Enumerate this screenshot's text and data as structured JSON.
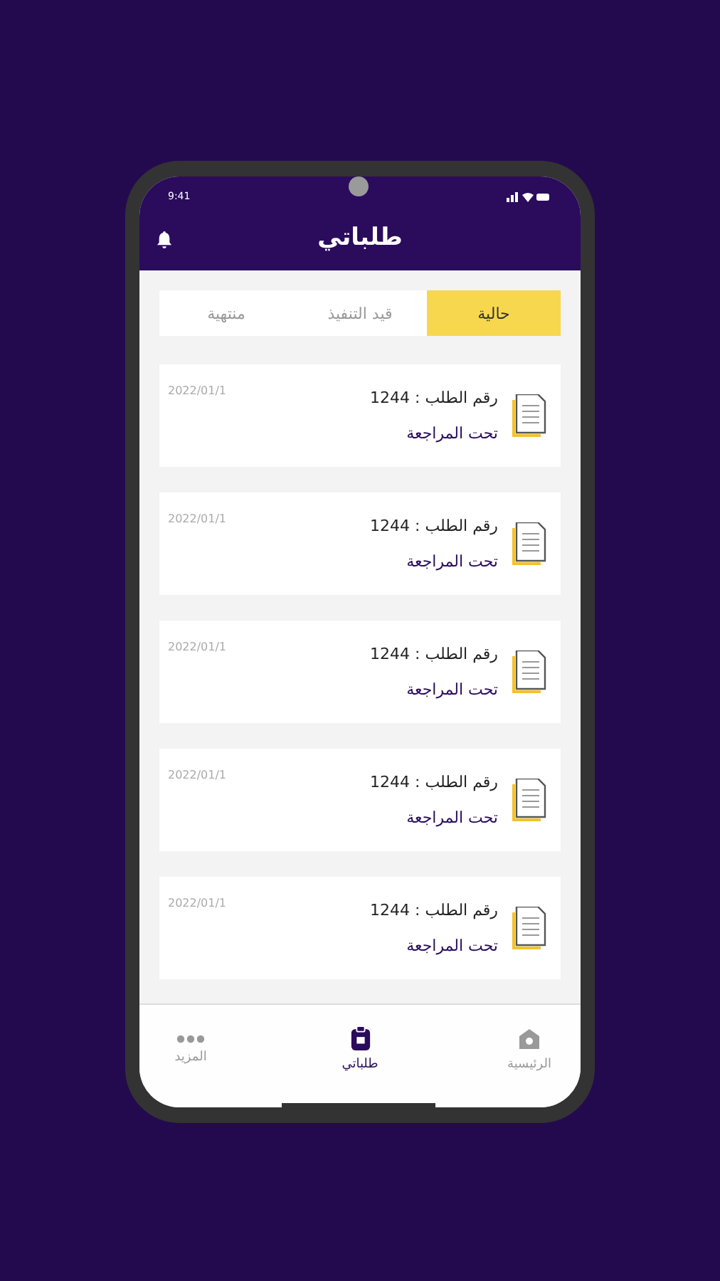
{
  "status_bar": {
    "time": "9:41"
  },
  "header": {
    "title": "طلباتي"
  },
  "tabs": [
    {
      "label": "حالية",
      "selected": true
    },
    {
      "label": "قيد التنفيذ",
      "selected": false
    },
    {
      "label": "منتهية",
      "selected": false
    }
  ],
  "orders": [
    {
      "number_label": "رقم الطلب : 1244",
      "status": "تحت المراجعة",
      "date": "2022/01/1"
    },
    {
      "number_label": "رقم الطلب : 1244",
      "status": "تحت المراجعة",
      "date": "2022/01/1"
    },
    {
      "number_label": "رقم الطلب : 1244",
      "status": "تحت المراجعة",
      "date": "2022/01/1"
    },
    {
      "number_label": "رقم الطلب : 1244",
      "status": "تحت المراجعة",
      "date": "2022/01/1"
    },
    {
      "number_label": "رقم الطلب : 1244",
      "status": "تحت المراجعة",
      "date": "2022/01/1"
    }
  ],
  "bottom_nav": [
    {
      "kind": "home",
      "label": "الرئيسية",
      "selected": false
    },
    {
      "kind": "orders",
      "label": "طلباتي",
      "selected": true
    },
    {
      "kind": "more",
      "label": "المزيد",
      "selected": false
    }
  ]
}
